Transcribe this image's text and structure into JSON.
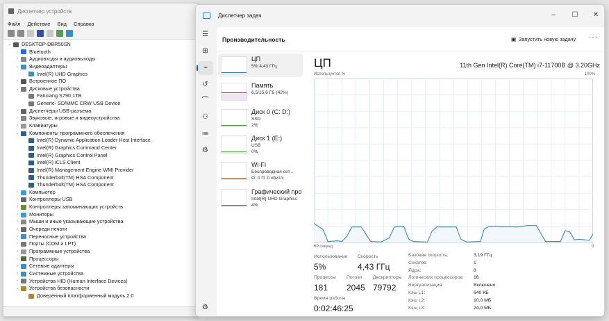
{
  "device_manager": {
    "title": "Диспетчер устройств",
    "menu": [
      "Файл",
      "Действие",
      "Вид",
      "Справка"
    ],
    "tree": [
      {
        "label": "DESKTOP-DBR50SN",
        "level": 0,
        "exp": "v",
        "color": "#555"
      },
      {
        "label": "Bluetooth",
        "level": 1,
        "exp": ">",
        "color": "#1e6fd9"
      },
      {
        "label": "Аудиовходы и аудиовыходы",
        "level": 1,
        "exp": ">",
        "color": "#888"
      },
      {
        "label": "Видеоадаптеры",
        "level": 1,
        "exp": "v",
        "color": "#3a8fc8"
      },
      {
        "label": "Intel(R) UHD Graphics",
        "level": 2,
        "exp": "",
        "color": "#3a8fc8"
      },
      {
        "label": "Встроенное ПО",
        "level": 1,
        "exp": ">",
        "color": "#555"
      },
      {
        "label": "Дисковые устройства",
        "level": 1,
        "exp": "v",
        "color": "#777"
      },
      {
        "label": "Fanxiang S790 1TB",
        "level": 2,
        "exp": "",
        "color": "#777"
      },
      {
        "label": "Generic- SD/MMC CRW USB Device",
        "level": 2,
        "exp": "",
        "color": "#777"
      },
      {
        "label": "Диспетчеры USB-разъема",
        "level": 1,
        "exp": ">",
        "color": "#666"
      },
      {
        "label": "Звуковые, игровые и видеоустройства",
        "level": 1,
        "exp": ">",
        "color": "#888"
      },
      {
        "label": "Клавиатуры",
        "level": 1,
        "exp": ">",
        "color": "#999"
      },
      {
        "label": "Компоненты программного обеспечения",
        "level": 1,
        "exp": "v",
        "color": "#2d5e8c"
      },
      {
        "label": "Intel(R) Dynamic Application Loader Host Interface",
        "level": 2,
        "exp": "",
        "color": "#2d5e8c"
      },
      {
        "label": "Intel(R) Graphics Command Center",
        "level": 2,
        "exp": "",
        "color": "#2d5e8c"
      },
      {
        "label": "Intel(R) Graphics Control Panel",
        "level": 2,
        "exp": "",
        "color": "#2d5e8c"
      },
      {
        "label": "Intel(R) iCLS Client",
        "level": 2,
        "exp": "",
        "color": "#2d5e8c"
      },
      {
        "label": "Intel(R) Management Engine WMI Provider",
        "level": 2,
        "exp": "",
        "color": "#2d5e8c"
      },
      {
        "label": "Thunderbolt(TM) HSA Component",
        "level": 2,
        "exp": "",
        "color": "#2d5e8c"
      },
      {
        "label": "Thunderbolt(TM) HSA Component",
        "level": 2,
        "exp": "",
        "color": "#2d5e8c"
      },
      {
        "label": "Компьютер",
        "level": 1,
        "exp": ">",
        "color": "#3a9ad9"
      },
      {
        "label": "Контроллеры USB",
        "level": 1,
        "exp": ">",
        "color": "#666"
      },
      {
        "label": "Контроллеры запоминающих устройств",
        "level": 1,
        "exp": ">",
        "color": "#6a8a3a"
      },
      {
        "label": "Мониторы",
        "level": 1,
        "exp": ">",
        "color": "#3a9ad9"
      },
      {
        "label": "Мыши и иные указывающие устройства",
        "level": 1,
        "exp": ">",
        "color": "#888"
      },
      {
        "label": "Очереди печати",
        "level": 1,
        "exp": ">",
        "color": "#666"
      },
      {
        "label": "Переносные устройства",
        "level": 1,
        "exp": ">",
        "color": "#3a8fc8"
      },
      {
        "label": "Порты (COM и LPT)",
        "level": 1,
        "exp": ">",
        "color": "#777"
      },
      {
        "label": "Программные устройства",
        "level": 1,
        "exp": ">",
        "color": "#999"
      },
      {
        "label": "Процессоры",
        "level": 1,
        "exp": ">",
        "color": "#4a6a3a"
      },
      {
        "label": "Сетевые адаптеры",
        "level": 1,
        "exp": ">",
        "color": "#3a8fc8"
      },
      {
        "label": "Системные устройства",
        "level": 1,
        "exp": ">",
        "color": "#3a8fc8"
      },
      {
        "label": "Устройства HID (Human Interface Devices)",
        "level": 1,
        "exp": ">",
        "color": "#777"
      },
      {
        "label": "Устройства безопасности",
        "level": 1,
        "exp": "v",
        "color": "#b08a2a"
      },
      {
        "label": "Доверенный платформенный модуль 2.0",
        "level": 2,
        "exp": "",
        "color": "#b08a2a"
      }
    ]
  },
  "task_manager": {
    "title": "Диспетчер задач",
    "header": "Производительность",
    "new_task": "Запустить новую задачу",
    "more": "···",
    "perf_items": [
      {
        "name": "ЦП",
        "sub1": "5% 4,43 ГГц",
        "sub2": "",
        "color": "#2c7fb8"
      },
      {
        "name": "Память",
        "sub1": "6,5/15,6 ГБ (42%)",
        "sub2": "",
        "color": "#8b3a8b"
      },
      {
        "name": "Диск 0 (C: D:)",
        "sub1": "SSD",
        "sub2": "2%",
        "color": "#4a9a3a"
      },
      {
        "name": "Диск 1 (E:)",
        "sub1": "USB",
        "sub2": "0%",
        "color": "#4a9a3a"
      },
      {
        "name": "Wi-Fi",
        "sub1": "Беспроводная сет...",
        "sub2": "О: 0 П: 0 кбит/с",
        "color": "#a0612a"
      },
      {
        "name": "Графический про",
        "sub1": "Intel(R) UHD Graphics",
        "sub2": "4%",
        "color": "#2c7fb8"
      }
    ],
    "cpu": {
      "title": "ЦП",
      "model": "11th Gen Intel(R) Core(TM) i7-11700B @ 3.20GHz",
      "usage_label": "Используется %",
      "max_label": "100%",
      "left_label": "60 секунд",
      "right_label": "0",
      "stats": {
        "usage_label": "Использование",
        "usage": "5%",
        "speed_label": "Скорость",
        "speed": "4,43 ГГц",
        "processes_label": "Процессы",
        "processes": "181",
        "threads_label": "Потоки",
        "threads": "2045",
        "handles_label": "Дескрипторы",
        "handles": "79792",
        "uptime_label": "Время работы",
        "uptime": "0:02:46:25"
      },
      "details": [
        {
          "k": "Базовая скорость:",
          "v": "3,19 ГГц"
        },
        {
          "k": "Сокетов:",
          "v": "1"
        },
        {
          "k": "Ядра:",
          "v": "8"
        },
        {
          "k": "Логических процессоров:",
          "v": "16"
        },
        {
          "k": "Виртуализация:",
          "v": "Включено"
        },
        {
          "k": "Кэш L1:",
          "v": "640 КБ"
        },
        {
          "k": "Кэш L2:",
          "v": "10,0 МБ"
        },
        {
          "k": "Кэш L3:",
          "v": "24,0 МБ"
        }
      ]
    }
  },
  "chart_data": {
    "type": "area",
    "title": "ЦП",
    "ylabel": "Используется %",
    "xlabel": "60 секунд",
    "ylim": [
      0,
      100
    ],
    "xlim": [
      0,
      60
    ],
    "grid": true,
    "x": [
      0,
      2,
      3,
      5,
      6,
      7,
      8.2,
      10.2,
      12.2,
      14.4,
      16.2,
      17.3,
      19.3,
      20.4,
      21.4,
      24.4,
      25.4,
      26.4,
      30.6,
      31.6,
      32.8,
      35.8,
      36.6,
      37.8,
      43.8,
      45.8,
      47.8,
      49.8,
      53,
      54,
      55,
      56,
      57,
      59.2,
      60
    ],
    "values": [
      11.6,
      7.9,
      0.6,
      1.0,
      0.6,
      3.4,
      9.5,
      9.5,
      0.6,
      0.3,
      2.7,
      9.5,
      9.9,
      2.0,
      0.6,
      0.3,
      6.9,
      9.5,
      9.5,
      2.0,
      0.3,
      0.6,
      8.3,
      9.9,
      9.5,
      10.3,
      10.3,
      0.6,
      0.6,
      7.2,
      6.5,
      1.6,
      2.0,
      1.3,
      5.2
    ],
    "color": "#4a8fb0"
  }
}
